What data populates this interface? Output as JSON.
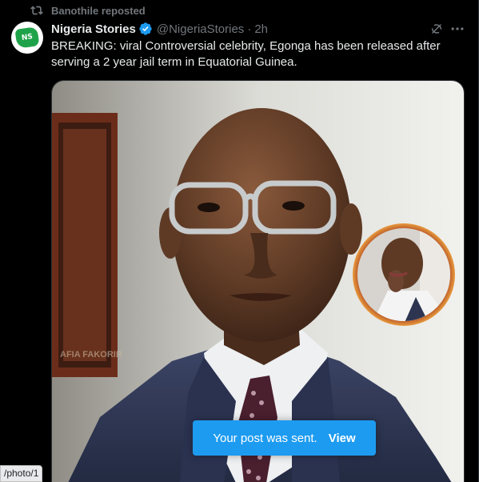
{
  "repost": {
    "label": "Banothile reposted",
    "icon": "repost-icon"
  },
  "author": {
    "avatar_text": "NS",
    "name": "Nigeria Stories",
    "handle": "@NigeriaStories",
    "separator": "·",
    "time": "2h",
    "verified_color": "#1d9bf0"
  },
  "tweet": {
    "text": "BREAKING: viral Controversial celebrity, Egonga has been released after serving a 2 year jail term in Equatorial Guinea."
  },
  "media": {
    "watermark": "AFIA FAKORIR"
  },
  "toast": {
    "message": "Your post was sent.",
    "action": "View",
    "color": "#1d9bf0"
  },
  "status_url": "/photo/1"
}
